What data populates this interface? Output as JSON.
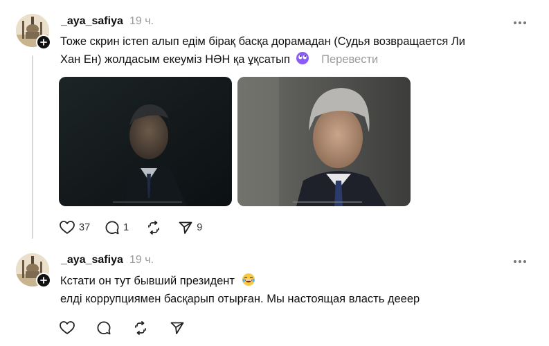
{
  "posts": [
    {
      "username": "_aya_safiya",
      "time": "19 ч.",
      "text_lines": [
        "Тоже скрин істеп алып едім бірақ басқа дорамадан (Судья возвращается Ли",
        "Хан Ен) жолдасым екеуміз НӘН қа ұқсатып"
      ],
      "emoji": "eyes-rolling-emoji",
      "translate_label": "Перевести",
      "likes": "37",
      "replies": "1",
      "shares": "9"
    },
    {
      "username": "_aya_safiya",
      "time": "19 ч.",
      "text_lines": [
        "Кстати он тут бывший президент",
        "елді коррупциямен басқарып отырған. Мы настоящая власть дееep"
      ],
      "emoji": "laughing-emoji"
    }
  ],
  "icons": {
    "like": "heart-icon",
    "reply": "comment-icon",
    "repost": "repost-icon",
    "share": "send-icon",
    "more": "more-dots-icon",
    "follow": "plus-icon"
  },
  "colors": {
    "text": "#111111",
    "muted": "#9a9a9a",
    "emoji_purple": "#8b5cf6",
    "emoji_yellow": "#f7c948"
  }
}
